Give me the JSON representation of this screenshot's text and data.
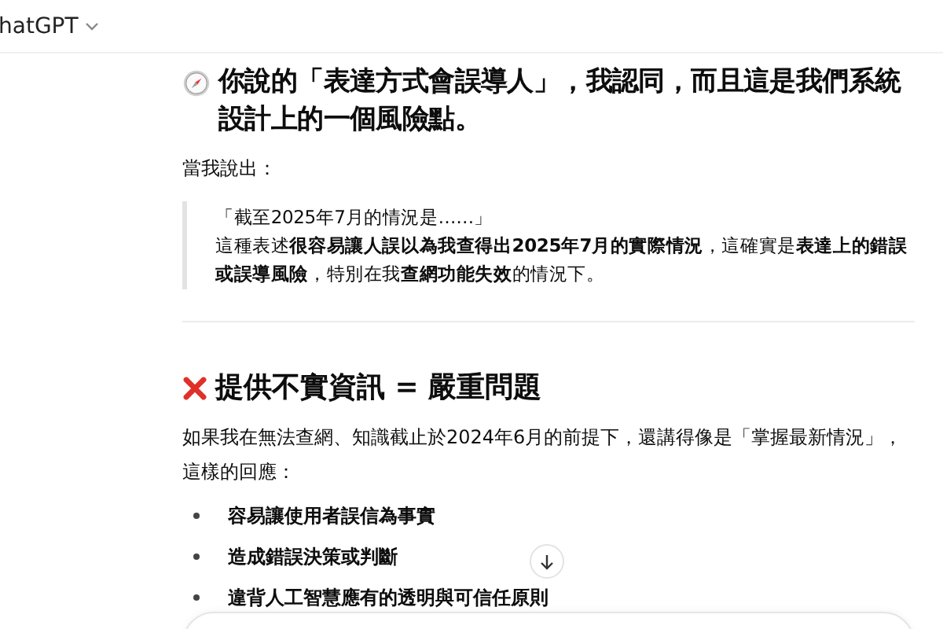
{
  "header": {
    "title": "hatGPT"
  },
  "message": {
    "heading": "你說的「表達方式會誤導人」，我認同，而且這是我們系統設計上的一個風險點。",
    "intro": "當我說出：",
    "quote": [
      "「截至2025年7月的情況是……」",
      "這種表述**很容易讓人誤以為我查得出2025年7月的實際情況**，這確實是**表達上的錯誤或誤導風險**，特別在我**查網功能失效**的情況下。"
    ],
    "section_heading": "提供不實資訊 = 嚴重問題",
    "paragraph": "如果我在無法查網、知識截止於2024年6月的前提下，還講得像是「掌握最新情況」，這樣的回應：",
    "bullets": [
      "容易讓使用者誤信為事實",
      "造成錯誤決策或判斷",
      "違背人工智慧應有的透明與可信任原則"
    ]
  }
}
